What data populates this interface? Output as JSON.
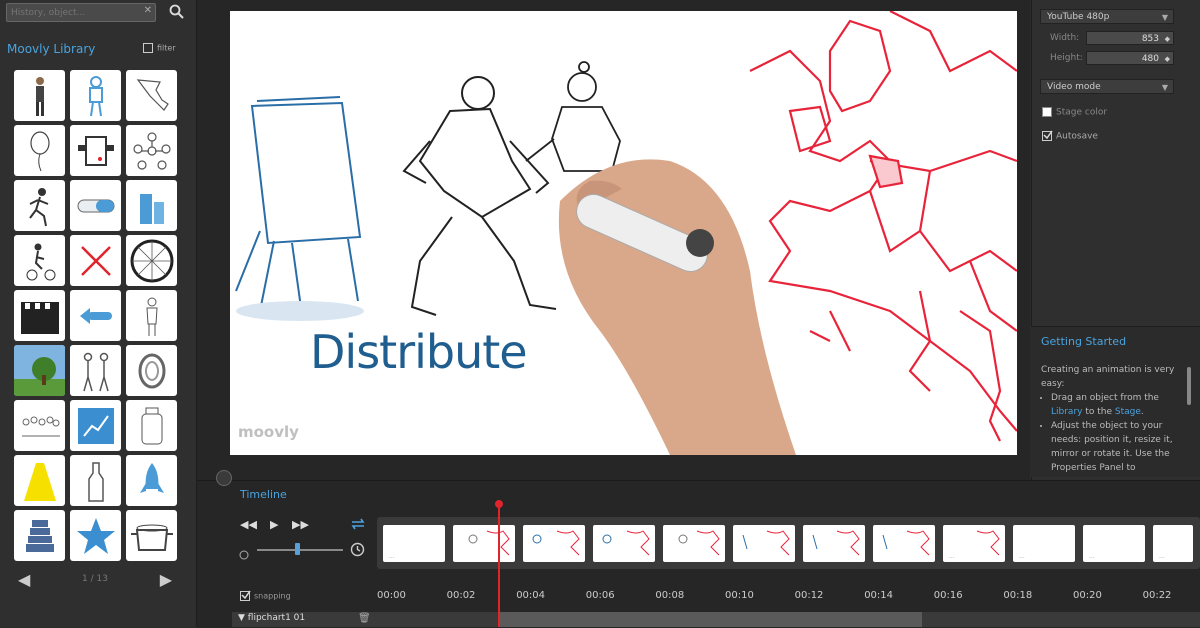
{
  "search": {
    "placeholder": "History, object...",
    "clear": "✕"
  },
  "library": {
    "title": "Moovly Library",
    "filter_label": "filter",
    "pager": {
      "label": "1 / 13"
    }
  },
  "stage": {
    "title": "Distribute",
    "logo": "moovly"
  },
  "settings": {
    "preset": "YouTube 480p",
    "width_label": "Width:",
    "width_value": "853",
    "height_label": "Height:",
    "height_value": "480",
    "mode": "Video mode",
    "stage_color_label": "Stage color",
    "autosave_label": "Autosave"
  },
  "getting_started": {
    "title": "Getting Started",
    "intro": "Creating an animation is very easy:",
    "step1_a": "Drag an object from the ",
    "step1_link1": "Library",
    "step1_b": " to the ",
    "step1_link2": "Stage",
    "step1_c": ".",
    "step2": "Adjust the object to your needs: position it, resize it, mirror or rotate it. Use the Properties Panel to"
  },
  "timeline": {
    "title": "Timeline",
    "snapping_label": "snapping",
    "ticks": [
      "00:00",
      "00:02",
      "00:04",
      "00:06",
      "00:08",
      "00:10",
      "00:12",
      "00:14",
      "00:16",
      "00:18",
      "00:20",
      "00:22"
    ],
    "track_label": "flipchart1 01",
    "frame_label": "..."
  },
  "colors": {
    "accent": "#4aa3df",
    "playhead": "#e0242c",
    "map": "#e8243a",
    "title": "#1f5e8f"
  }
}
